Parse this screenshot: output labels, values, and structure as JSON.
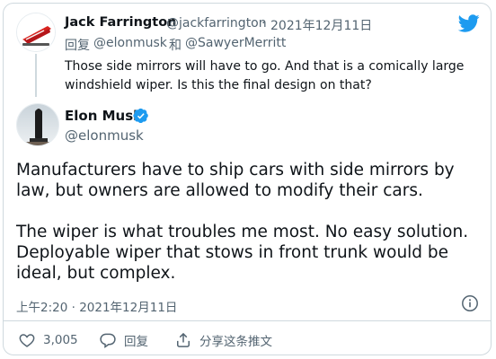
{
  "reply_tweet": {
    "display_name": "Jack Farrington",
    "handle": "@jackfarrington",
    "separator": "·",
    "date": "2021年12月11日",
    "reply_label": "回复",
    "reply_user_1": "@elonmusk",
    "reply_and": "和",
    "reply_user_2": "@SawyerMerritt",
    "text": "Those side mirrors will have to go. And that is a comically large windshield wiper. Is this the final design on that?"
  },
  "main_tweet": {
    "display_name": "Elon Musk",
    "handle": "@elonmusk",
    "paragraph_1": "Manufacturers have to ship cars with side mirrors by law, but owners are allowed to modify their cars.",
    "paragraph_2": "The wiper is what troubles me most. No easy solution. Deployable wiper that stows in front trunk would be ideal, but complex.",
    "timestamp": "上午2:20 · 2021年12月11日"
  },
  "actions": {
    "like_count": "3,005",
    "reply_label": "回复",
    "share_label": "分享这条推文"
  },
  "colors": {
    "twitter_blue": "#1d9bf0",
    "secondary_text": "#536471",
    "primary_text": "#0f1419",
    "border": "#cfd9de"
  },
  "icons": [
    "twitter-bird-icon",
    "verified-badge-icon",
    "info-icon",
    "heart-icon",
    "reply-bubble-icon",
    "share-icon"
  ]
}
